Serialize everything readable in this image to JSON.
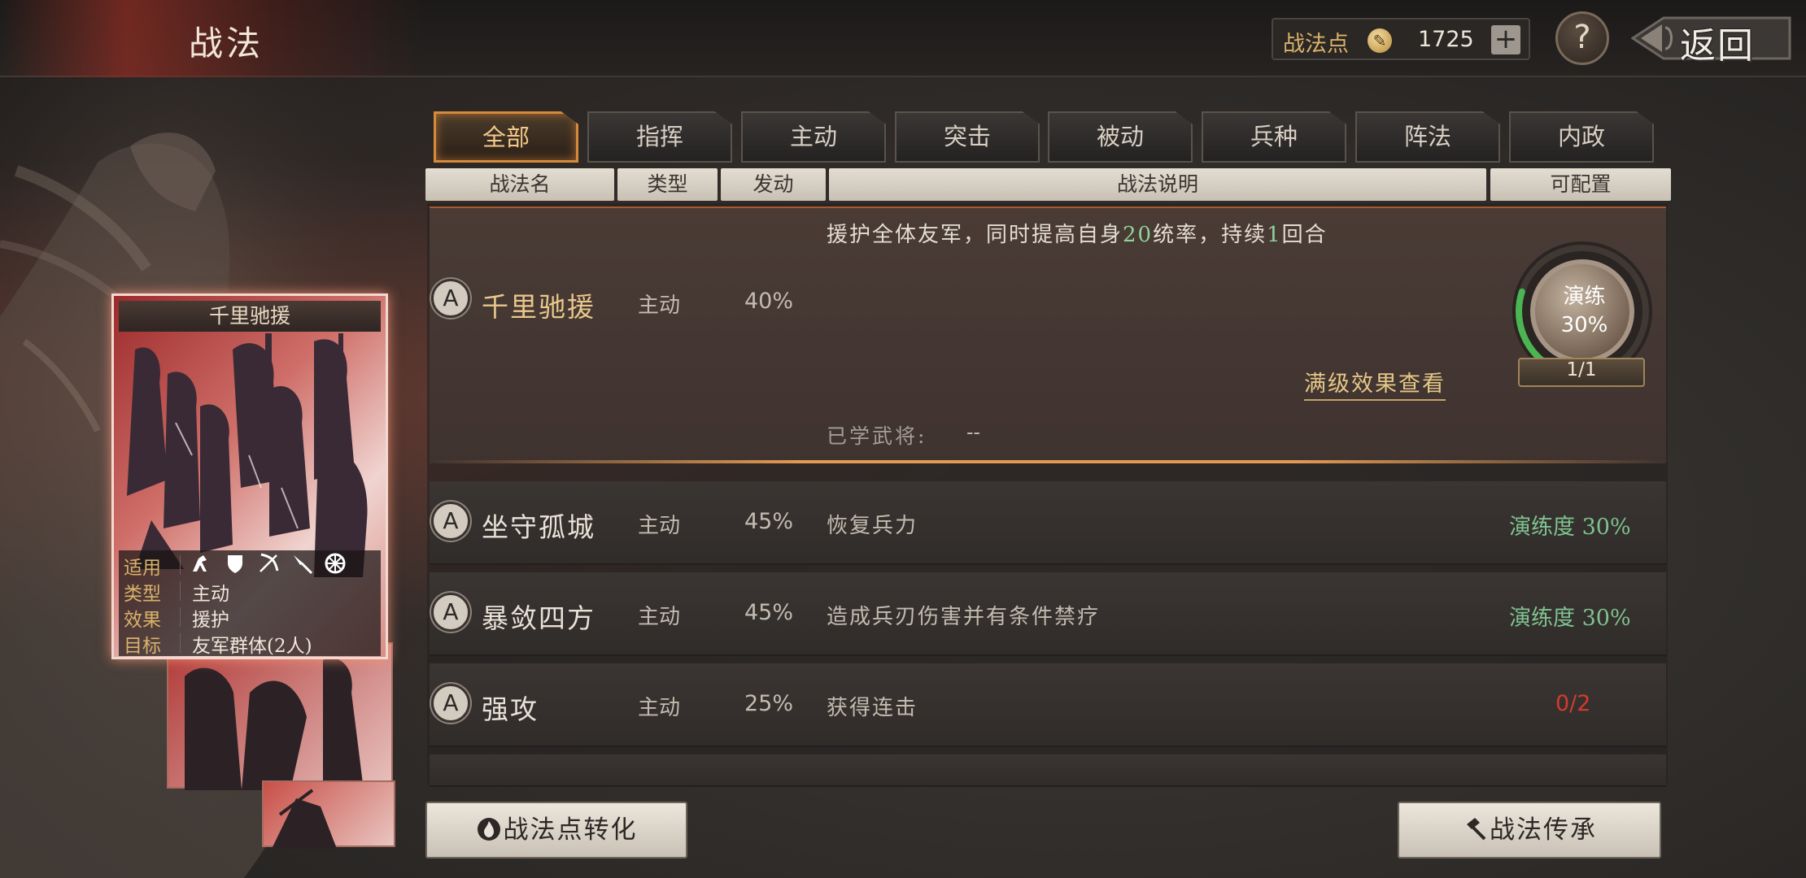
{
  "header": {
    "title": "战法",
    "points_label": "战法点",
    "points_value": "1725",
    "plus_label": "+",
    "help_label": "?",
    "back_label": "返回"
  },
  "tabs": [
    {
      "label": "全部",
      "active": true
    },
    {
      "label": "指挥",
      "active": false
    },
    {
      "label": "主动",
      "active": false
    },
    {
      "label": "突击",
      "active": false
    },
    {
      "label": "被动",
      "active": false
    },
    {
      "label": "兵种",
      "active": false
    },
    {
      "label": "阵法",
      "active": false
    },
    {
      "label": "内政",
      "active": false
    }
  ],
  "columns": [
    "战法名",
    "类型",
    "发动",
    "战法说明",
    "可配置"
  ],
  "card": {
    "name": "千里驰援",
    "applicable_label": "适用",
    "applicable_icons": [
      "cavalry-icon",
      "shield-icon",
      "bow-icon",
      "spear-icon",
      "wheel-icon"
    ],
    "type_label": "类型",
    "type_value": "主动",
    "effect_label": "效果",
    "effect_value": "援护",
    "target_label": "目标",
    "target_value": "友军群体(2人)"
  },
  "expanded_skill": {
    "badge": "A",
    "name": "千里驰援",
    "type": "主动",
    "rate": "40%",
    "desc_part1": "援护全体友军，同时提高自身",
    "desc_num1": "20",
    "desc_part2": "统率，持续",
    "desc_num2": "1",
    "desc_part3": "回合",
    "max_level_link": "满级效果查看",
    "learned_label": "已学武将:",
    "learned_value": "--",
    "practice_label": "演练",
    "practice_pct": "30%",
    "practice_fraction": 0.3,
    "practice_count": "1/1"
  },
  "skills": [
    {
      "badge": "A",
      "name": "坐守孤城",
      "type": "主动",
      "rate": "45%",
      "desc": "恢复兵力",
      "status": "演练度 30%",
      "status_kind": "green"
    },
    {
      "badge": "A",
      "name": "暴敛四方",
      "type": "主动",
      "rate": "45%",
      "desc": "造成兵刃伤害并有条件禁疗",
      "status": "演练度 30%",
      "status_kind": "green"
    },
    {
      "badge": "A",
      "name": "强攻",
      "type": "主动",
      "rate": "25%",
      "desc": "获得连击",
      "status": "0/2",
      "status_kind": "red"
    }
  ],
  "buttons": {
    "convert": "战法点转化",
    "inherit": "战法传承"
  },
  "colors": {
    "accent_orange": "#d68a3a",
    "status_green": "#7fc28f",
    "status_red": "#d23a2e",
    "gold_text": "#d9b26a"
  }
}
